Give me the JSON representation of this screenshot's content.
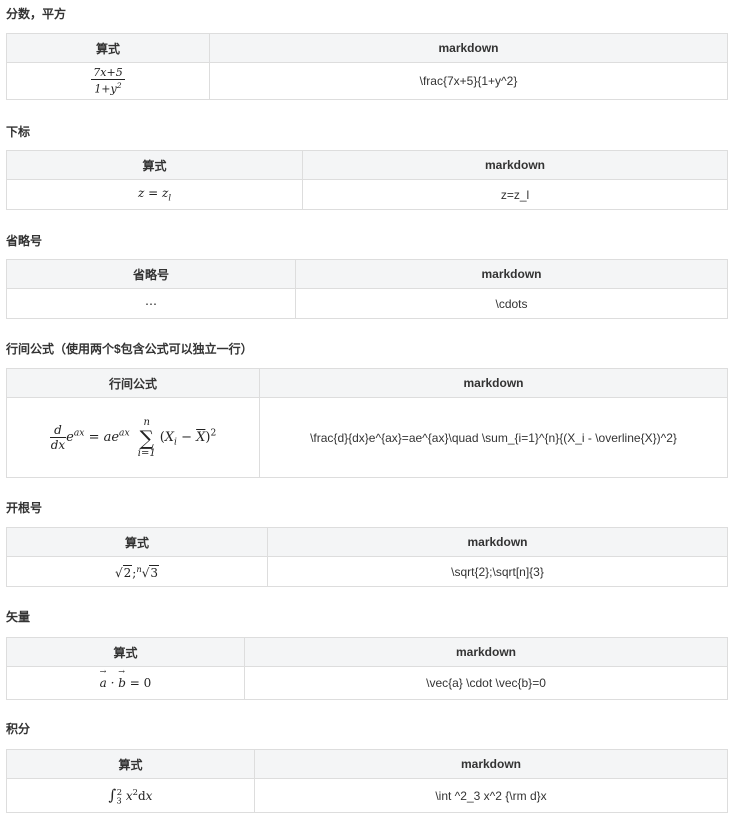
{
  "sections": [
    {
      "title": "分数，平方",
      "col1": "算式",
      "col2": "markdown",
      "code": "\\frac{7x+5}{1+y^2}"
    },
    {
      "title": "下标",
      "col1": "算式",
      "col2": "markdown",
      "code": "z=z_l"
    },
    {
      "title": "省略号",
      "col1": "省略号",
      "col2": "markdown",
      "code": "\\cdots"
    },
    {
      "title": "行间公式（使用两个$包含公式可以独立一行）",
      "col1": "行间公式",
      "col2": "markdown",
      "code": "\\frac{d}{dx}e^{ax}=ae^{ax}\\quad \\sum_{i=1}^{n}{(X_i - \\overline{X})^2}"
    },
    {
      "title": "开根号",
      "col1": "算式",
      "col2": "markdown",
      "code": "\\sqrt{2};\\sqrt[n]{3}"
    },
    {
      "title": "矢量",
      "col1": "算式",
      "col2": "markdown",
      "code": "\\vec{a} \\cdot \\vec{b}=0"
    },
    {
      "title": "积分",
      "col1": "算式",
      "col2": "markdown",
      "code": "\\int ^2_3 x^2 {\\rm d}x"
    }
  ]
}
